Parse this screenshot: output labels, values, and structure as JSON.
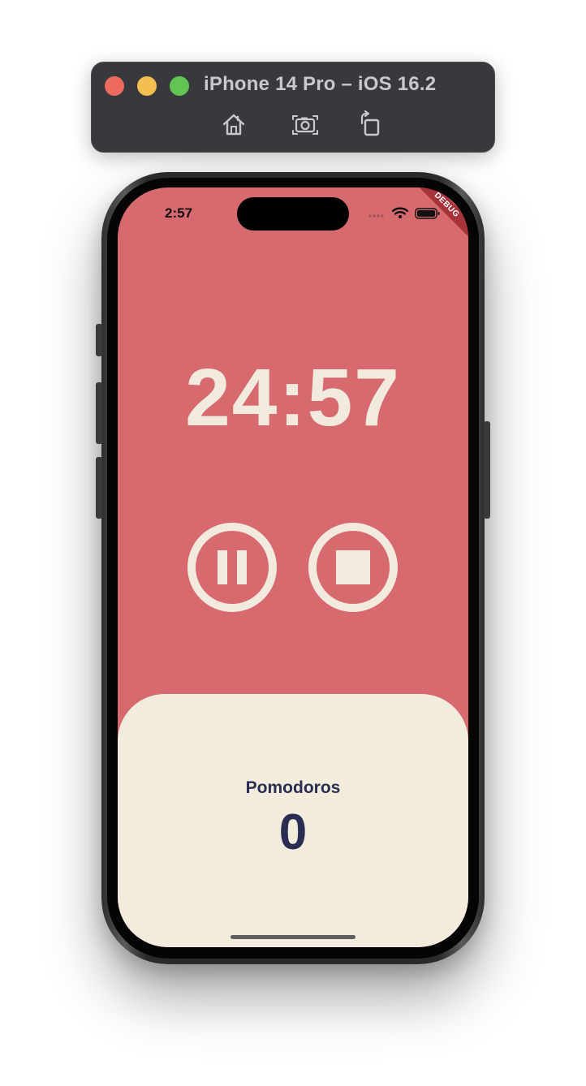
{
  "simulator": {
    "title": "iPhone 14 Pro – iOS 16.2",
    "toolbar": [
      "home-icon",
      "screenshot-icon",
      "rotate-icon"
    ]
  },
  "status_bar": {
    "time": "2:57",
    "debug_banner": "DEBUG"
  },
  "timer": {
    "display": "24:57"
  },
  "controls": {
    "pause_icon": "pause-icon",
    "stop_icon": "stop-icon"
  },
  "counter": {
    "label": "Pomodoros",
    "value": "0"
  },
  "colors": {
    "primary": "#d76a6e",
    "cream": "#f2ebdd",
    "text_dark": "#2a2d52"
  }
}
